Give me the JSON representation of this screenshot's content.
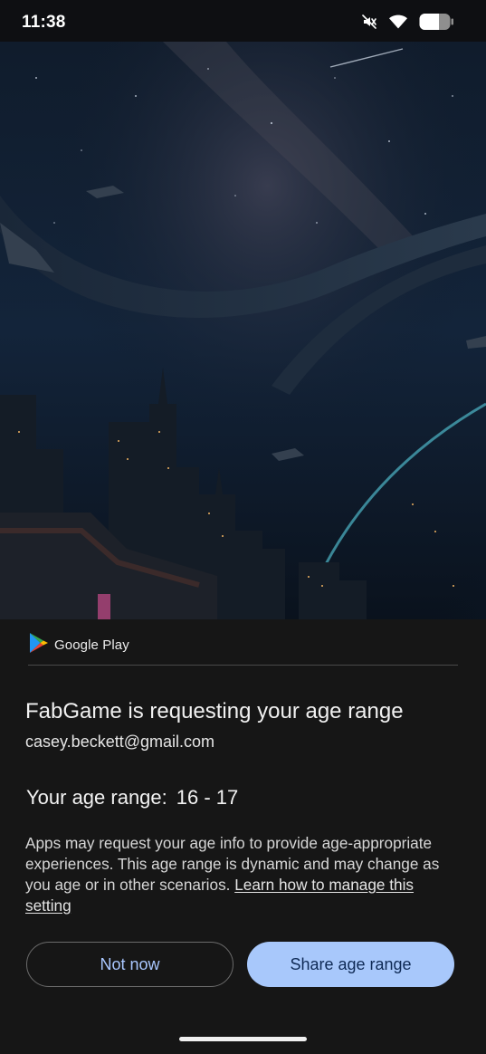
{
  "status_bar": {
    "time": "11:38",
    "icons": [
      "mute-icon",
      "wifi-icon",
      "battery-icon"
    ]
  },
  "hero": {
    "description_icon": "space-city-artwork"
  },
  "sheet": {
    "provider": {
      "label": "Google Play",
      "icon": "google-play-icon"
    },
    "title": "FabGame is requesting your age range",
    "account_email": "casey.beckett@gmail.com",
    "age_label": "Your age range:",
    "age_value": "16 - 17",
    "description": "Apps may request your age info to provide age-appropriate experiences. This age range is dynamic and may change as you age or in other scenarios.",
    "learn_more_link": "Learn how to manage this setting",
    "buttons": {
      "secondary": "Not now",
      "primary": "Share age range"
    }
  },
  "colors": {
    "sheet_background": "#161616",
    "primary_button": "#a8c8fb",
    "secondary_button_text": "#a9c7ff"
  }
}
